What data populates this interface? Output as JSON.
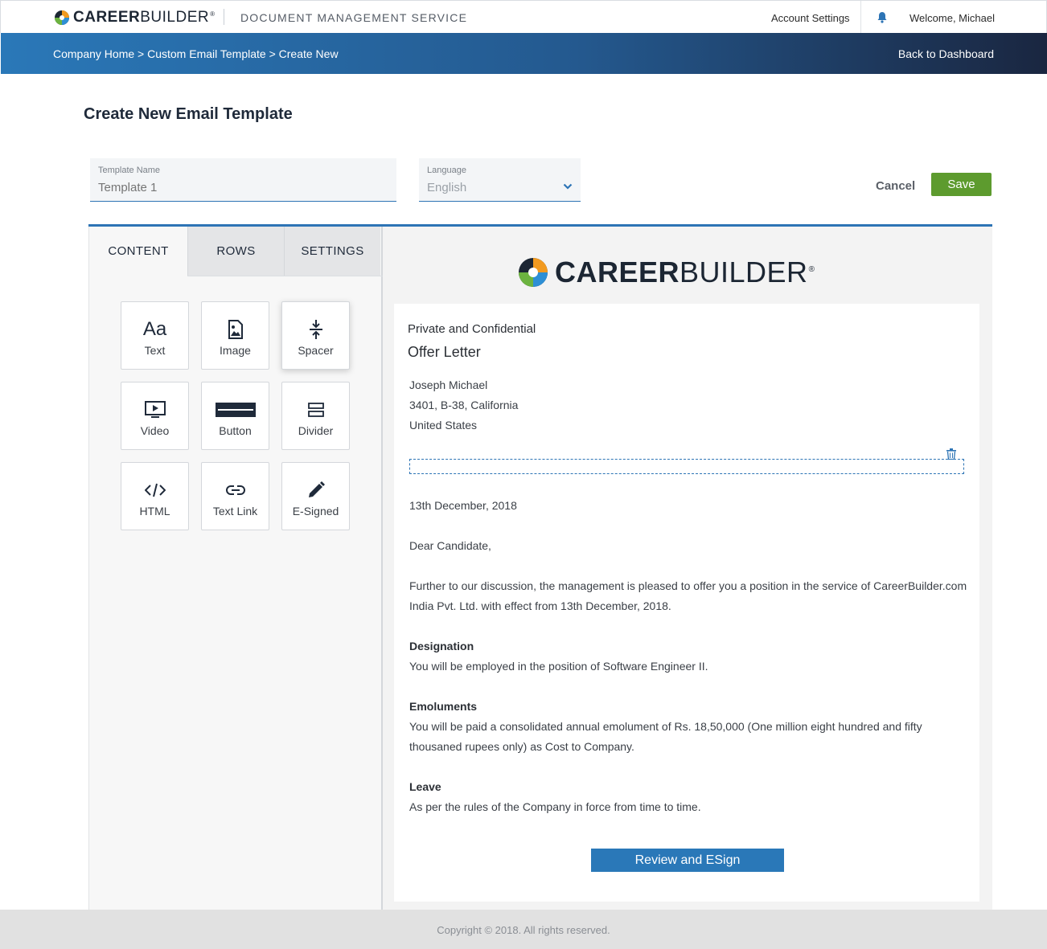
{
  "header": {
    "brand_bold": "CAREER",
    "brand_light": "BUILDER",
    "brand_reg": "®",
    "service_title": "DOCUMENT MANAGEMENT SERVICE",
    "account_settings": "Account Settings",
    "welcome": "Welcome, Michael"
  },
  "breadcrumb": {
    "path": "Company Home > Custom Email Template > Create New",
    "back": "Back to Dashboard"
  },
  "page": {
    "title": "Create New Email Template"
  },
  "form": {
    "template_name_label": "Template Name",
    "template_name_value": "Template 1",
    "language_label": "Language",
    "language_value": "English",
    "cancel": "Cancel",
    "save": "Save"
  },
  "tabs": [
    "CONTENT",
    "ROWS",
    "SETTINGS"
  ],
  "content_blocks": [
    {
      "label": "Text",
      "icon": "text-icon"
    },
    {
      "label": "Image",
      "icon": "image-icon"
    },
    {
      "label": "Spacer",
      "icon": "spacer-icon"
    },
    {
      "label": "Video",
      "icon": "video-icon"
    },
    {
      "label": "Button",
      "icon": "button-icon"
    },
    {
      "label": "Divider",
      "icon": "divider-icon"
    },
    {
      "label": "HTML",
      "icon": "code-icon"
    },
    {
      "label": "Text Link",
      "icon": "link-icon"
    },
    {
      "label": "E-Signed",
      "icon": "pencil-icon"
    }
  ],
  "text_icon_glyph": "Aa",
  "document": {
    "label": "Private and Confidential",
    "heading": "Offer Letter",
    "address": [
      "Joseph Michael",
      "3401, B-38, California",
      "United States"
    ],
    "date": "13th December, 2018",
    "greeting": "Dear Candidate,",
    "intro_1": "Further to our discussion, the management is pleased to offer you a position in the service of CareerBuilder.com",
    "intro_2": "India Pvt. Ltd. with effect from 13th December, 2018.",
    "designation_title": "Designation",
    "designation_text": "You will be employed in the position of Software Engineer II.",
    "emoluments_title": "Emoluments",
    "emoluments_1": "You will be paid a consolidated annual emolument of Rs. 18,50,000 (One million eight hundred and fifty",
    "emoluments_2": "thousaned rupees only) as Cost to Company.",
    "leave_title": "Leave",
    "leave_text": "As per the rules of the Company in force from time to time.",
    "cta": "Review and ESign"
  },
  "footer": {
    "copyright": "Copyright © 2018. All rights reserved."
  },
  "colors": {
    "accent": "#2d74b5",
    "save_green": "#5d9b2e",
    "header_dark": "#1a2640"
  }
}
